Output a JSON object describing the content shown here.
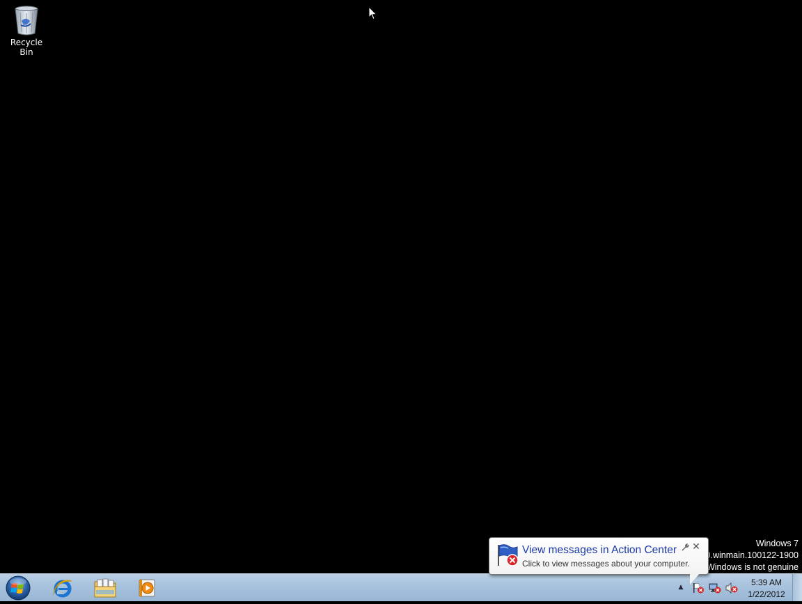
{
  "desktop": {
    "icons": [
      {
        "label": "Recycle Bin",
        "icon": "recycle-bin-icon"
      }
    ]
  },
  "watermark": {
    "line1": "Windows 7",
    "line2": "00.winmain.100122-1900",
    "line3": "Windows is not genuine"
  },
  "balloon": {
    "title": "View messages in Action Center",
    "text": "Click to view messages about your computer.",
    "close": "✕",
    "icon": "action-center-flag-icon"
  },
  "taskbar": {
    "start_icon": "windows-start-orb-icon",
    "pinned": [
      {
        "name": "internet-explorer",
        "icon": "internet-explorer-icon"
      },
      {
        "name": "windows-explorer",
        "icon": "folder-library-icon"
      },
      {
        "name": "media-player",
        "icon": "media-player-icon"
      }
    ],
    "tray": {
      "overflow_arrow": "▲",
      "icons": [
        "action-center-error-icon",
        "network-error-icon",
        "volume-muted-icon"
      ]
    },
    "clock": {
      "time": "5:39 AM",
      "date": "1/22/2012"
    }
  },
  "colors": {
    "balloon_title": "#1c3aa9",
    "taskbar_top": "#b9cfe4",
    "taskbar_bottom": "#98b6d4",
    "desktop_bg": "#000000"
  }
}
